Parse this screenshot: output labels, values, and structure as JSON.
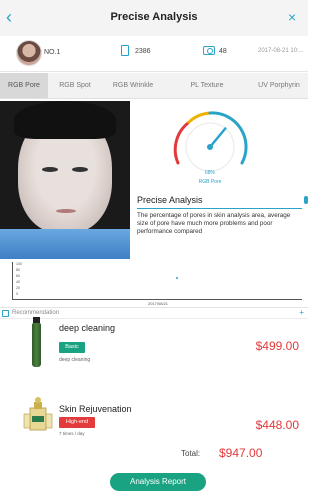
{
  "header": {
    "title": "Precise Analysis",
    "back_icon": "back-arrow-icon",
    "close_icon": "close-icon"
  },
  "user": {
    "id": "NO.1",
    "images_count": "2386",
    "photos_count": "48",
    "date": "2017-08-21 10:..."
  },
  "tabs": [
    {
      "label": "RGB Pore",
      "active": true
    },
    {
      "label": "RGB Spot",
      "active": false
    },
    {
      "label": "RGB Wrinkle",
      "active": false
    },
    {
      "label": "PL Texture",
      "active": false
    },
    {
      "label": "UV Porphyrin",
      "active": false
    }
  ],
  "gauge": {
    "value": "68%",
    "label": "RGB Pore",
    "level": 0.68
  },
  "analysis": {
    "title": "Precise Analysis",
    "description": "The percentage of pores in skin analysis area, average size of pore have much more problems and poor performance compared"
  },
  "trend": {
    "x_label": "2017/08/21",
    "y_ticks": [
      "100",
      "80",
      "60",
      "40",
      "20",
      "0"
    ]
  },
  "recommendation": {
    "label": "Recommendation",
    "products": [
      {
        "name": "deep cleaning",
        "badge": "Basic",
        "subtitle": "deep cleaning",
        "price": "$499.00",
        "badge_color": "#1aa383"
      },
      {
        "name": "Skin Rejuvenation",
        "badge": "High-end",
        "subtitle": "7 times / day",
        "price": "$448.00",
        "badge_color": "#e33b3b"
      }
    ],
    "total_label": "Total:",
    "total_value": "$947.00"
  },
  "actions": {
    "report_label": "Analysis Report"
  },
  "colors": {
    "accent": "#2aa3c8",
    "button": "#1aa383",
    "price": "#e03a3a"
  }
}
